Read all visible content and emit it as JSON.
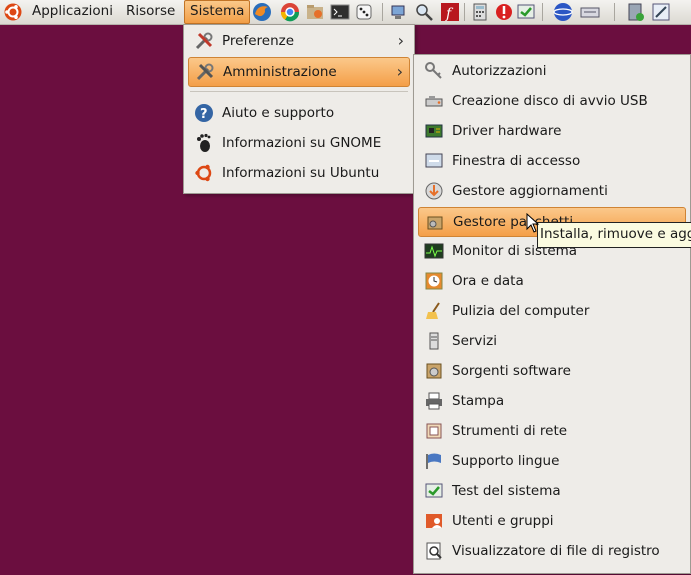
{
  "panel": {
    "menus": [
      "Applicazioni",
      "Risorse",
      "Sistema"
    ]
  },
  "sistema_menu": {
    "items": [
      {
        "label": "Preferenze",
        "icon": "tools-icon",
        "submenu": true
      },
      {
        "label": "Amministrazione",
        "icon": "tools-icon",
        "submenu": true
      },
      {
        "label": "Aiuto e supporto",
        "icon": "help-icon"
      },
      {
        "label": "Informazioni su GNOME",
        "icon": "gnome-foot-icon"
      },
      {
        "label": "Informazioni su Ubuntu",
        "icon": "ubuntu-icon"
      }
    ]
  },
  "admin_menu": {
    "items": [
      {
        "label": "Autorizzazioni"
      },
      {
        "label": "Creazione disco di avvio USB"
      },
      {
        "label": "Driver hardware"
      },
      {
        "label": "Finestra di accesso"
      },
      {
        "label": "Gestore aggiornamenti"
      },
      {
        "label": "Gestore pacchetti"
      },
      {
        "label": "Monitor di sistema"
      },
      {
        "label": "Ora e data"
      },
      {
        "label": "Pulizia del computer"
      },
      {
        "label": "Servizi"
      },
      {
        "label": "Sorgenti software"
      },
      {
        "label": "Stampa"
      },
      {
        "label": "Strumenti di rete"
      },
      {
        "label": "Supporto lingue"
      },
      {
        "label": "Test del sistema"
      },
      {
        "label": "Utenti e gruppi"
      },
      {
        "label": "Visualizzatore di file di registro"
      }
    ]
  },
  "tooltip": "Installa, rimuove e aggi",
  "colors": {
    "desktop": "#6b0e3f",
    "highlight": "#f49f48",
    "menu_bg": "#eeece8"
  }
}
